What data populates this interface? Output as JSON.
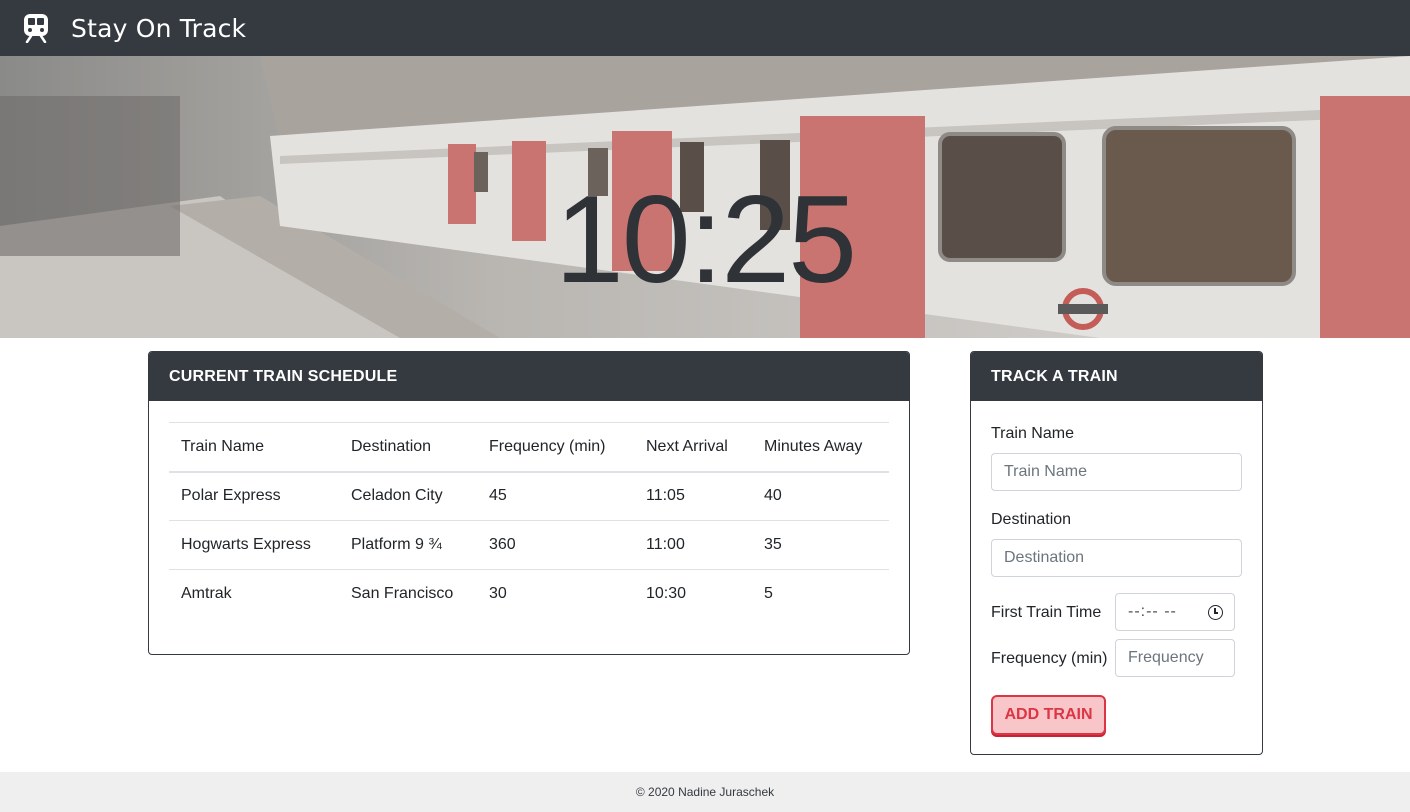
{
  "navbar": {
    "title": "Stay On Track",
    "icon": "train-icon"
  },
  "hero": {
    "clock": "10:25"
  },
  "schedule": {
    "header": "CURRENT TRAIN SCHEDULE",
    "columns": [
      "Train Name",
      "Destination",
      "Frequency (min)",
      "Next Arrival",
      "Minutes Away"
    ],
    "rows": [
      [
        "Polar Express",
        "Celadon City",
        "45",
        "11:05",
        "40"
      ],
      [
        "Hogwarts Express",
        "Platform 9 ¾",
        "360",
        "11:00",
        "35"
      ],
      [
        "Amtrak",
        "San Francisco",
        "30",
        "10:30",
        "5"
      ]
    ]
  },
  "track": {
    "header": "TRACK A TRAIN",
    "train_name_label": "Train Name",
    "train_name_placeholder": "Train Name",
    "destination_label": "Destination",
    "destination_placeholder": "Destination",
    "first_time_label": "First Train Time",
    "first_time_value": "--:-- --",
    "frequency_label": "Frequency (min)",
    "frequency_placeholder": "Frequency",
    "button": "ADD TRAIN"
  },
  "footer": {
    "text": "© 2020 Nadine Juraschek"
  },
  "colors": {
    "navbar": "#343a40",
    "accent": "#dc3545",
    "button_bg": "#f8c6c9",
    "footer_bg": "#efefef"
  }
}
